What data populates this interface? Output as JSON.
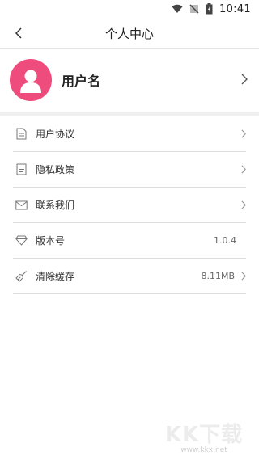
{
  "status_bar": {
    "time": "10:41",
    "icons": [
      "wifi-icon",
      "signal-off-icon",
      "battery-icon"
    ]
  },
  "header": {
    "title": "个人中心",
    "back_icon": "chevron-left-icon"
  },
  "profile": {
    "username": "用户名",
    "avatar_icon": "user-icon",
    "accent": "#ee4c7c"
  },
  "menu": {
    "items": [
      {
        "label": "用户协议",
        "icon": "document-icon",
        "value": ""
      },
      {
        "label": "隐私政策",
        "icon": "note-icon",
        "value": ""
      },
      {
        "label": "联系我们",
        "icon": "mail-icon",
        "value": ""
      },
      {
        "label": "版本号",
        "icon": "diamond-icon",
        "value": "1.0.4"
      },
      {
        "label": "清除缓存",
        "icon": "broom-icon",
        "value": "8.11MB"
      }
    ]
  },
  "watermark": {
    "logo": "KK下载",
    "url": "www.kkx.net"
  }
}
